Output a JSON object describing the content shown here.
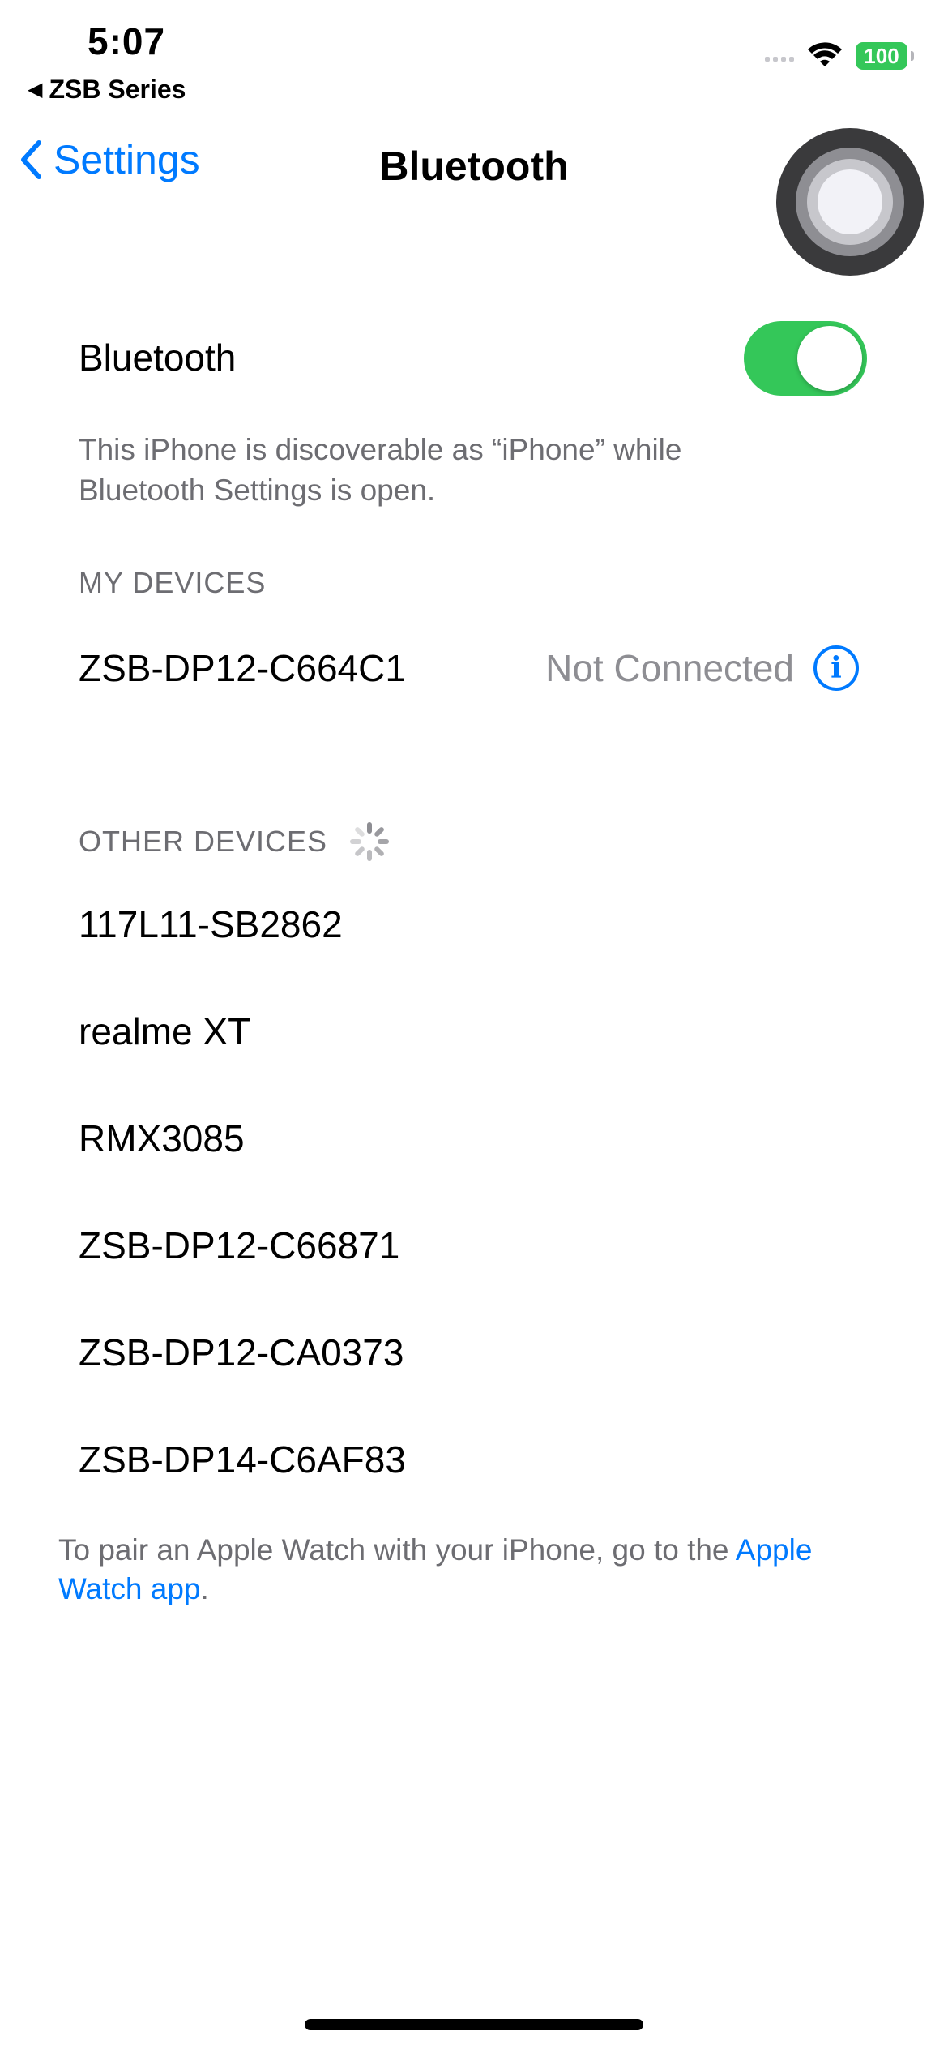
{
  "status_bar": {
    "time": "5:07",
    "back_app": "ZSB Series",
    "battery": "100",
    "colors": {
      "battery": "#34c759"
    }
  },
  "nav": {
    "back_label": "Settings",
    "title": "Bluetooth"
  },
  "bluetooth": {
    "label": "Bluetooth",
    "enabled": true,
    "discoverable_note": "This iPhone is discoverable as “iPhone” while Bluetooth Settings is open."
  },
  "my_devices": {
    "header": "MY DEVICES",
    "items": [
      {
        "name": "ZSB-DP12-C664C1",
        "status": "Not Connected"
      }
    ]
  },
  "other_devices": {
    "header": "OTHER DEVICES",
    "items": [
      {
        "name": "117L11-SB2862"
      },
      {
        "name": "realme XT"
      },
      {
        "name": "RMX3085"
      },
      {
        "name": "ZSB-DP12-C66871"
      },
      {
        "name": "ZSB-DP12-CA0373"
      },
      {
        "name": "ZSB-DP14-C6AF83"
      }
    ]
  },
  "footer": {
    "text": "To pair an Apple Watch with your iPhone, go to the ",
    "link": "Apple Watch app",
    "suffix": "."
  },
  "colors": {
    "accent": "#007aff",
    "toggle_on": "#34c759",
    "secondary_text": "#6d6d72"
  },
  "icons": {
    "nav_back": "chevron-left-icon",
    "info": "info-circle-icon",
    "wifi": "wifi-icon",
    "loading": "spinner-icon",
    "assistive_touch": "assistive-touch-icon"
  }
}
